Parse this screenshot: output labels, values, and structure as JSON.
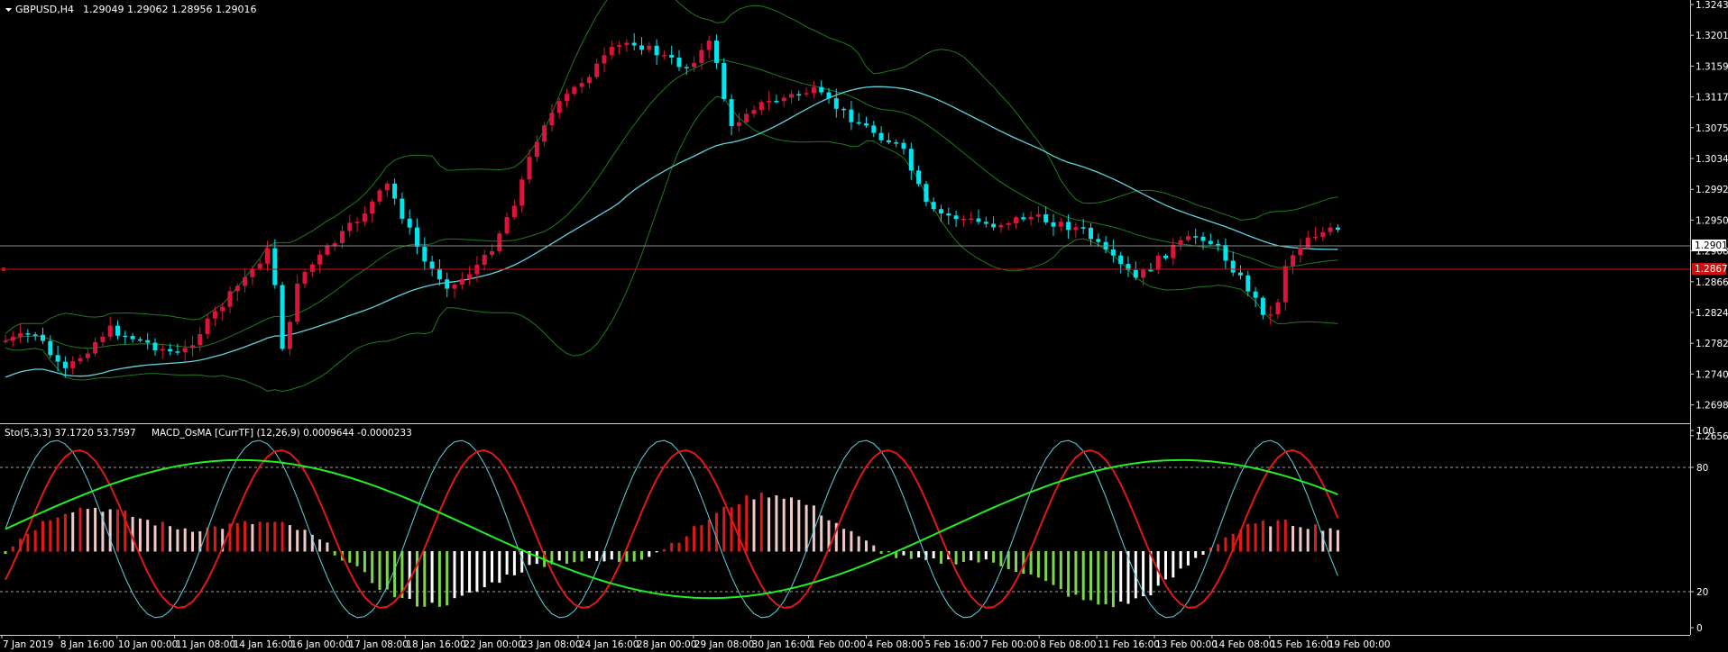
{
  "window": {
    "symbol_label": "GBPUSD,H4",
    "ohlc_label": "1.29049 1.29062 1.28956 1.29016"
  },
  "price_axis": {
    "ticks": [
      "1.32430",
      "1.32010",
      "1.31590",
      "1.31170",
      "1.30750",
      "1.30340",
      "1.29920",
      "1.29500",
      "1.29080",
      "1.28660",
      "1.28240",
      "1.27820",
      "1.27400",
      "1.26980",
      "1.26560"
    ],
    "current_price": "1.29016",
    "red_line_price": "1.28673"
  },
  "indicator": {
    "header_sto": "Sto(5,3,3) 37.1720 53.7597",
    "header_macd": "MACD_OsMA [CurrTF] (12,26,9) 0.0009644 -0.0000233",
    "levels": [
      "100",
      "80",
      "20",
      "0"
    ]
  },
  "time_axis": [
    "7 Jan 2019",
    "8 Jan 16:00",
    "10 Jan 00:00",
    "11 Jan 08:00",
    "14 Jan 16:00",
    "16 Jan 00:00",
    "17 Jan 08:00",
    "18 Jan 16:00",
    "22 Jan 00:00",
    "23 Jan 08:00",
    "24 Jan 16:00",
    "28 Jan 00:00",
    "29 Jan 08:00",
    "30 Jan 16:00",
    "1 Feb 00:00",
    "4 Feb 08:00",
    "5 Feb 16:00",
    "7 Feb 00:00",
    "8 Feb 08:00",
    "11 Feb 16:00",
    "13 Feb 00:00",
    "14 Feb 08:00",
    "15 Feb 16:00",
    "19 Feb 00:00"
  ],
  "colors": {
    "bull_candle": "#dc143c",
    "bear_candle": "#00e5ee",
    "bollinger": "#1e7a1e",
    "moving_average": "#5fd3e0",
    "red_level": "#cc1111",
    "osma_up": "#e01818",
    "osma_fading_up": "#f0c8c8",
    "osma_down": "#7cd64a",
    "osma_fading_down": "#ffffff",
    "stoch_main": "#e01818",
    "stoch_signal": "#22ee22"
  }
}
